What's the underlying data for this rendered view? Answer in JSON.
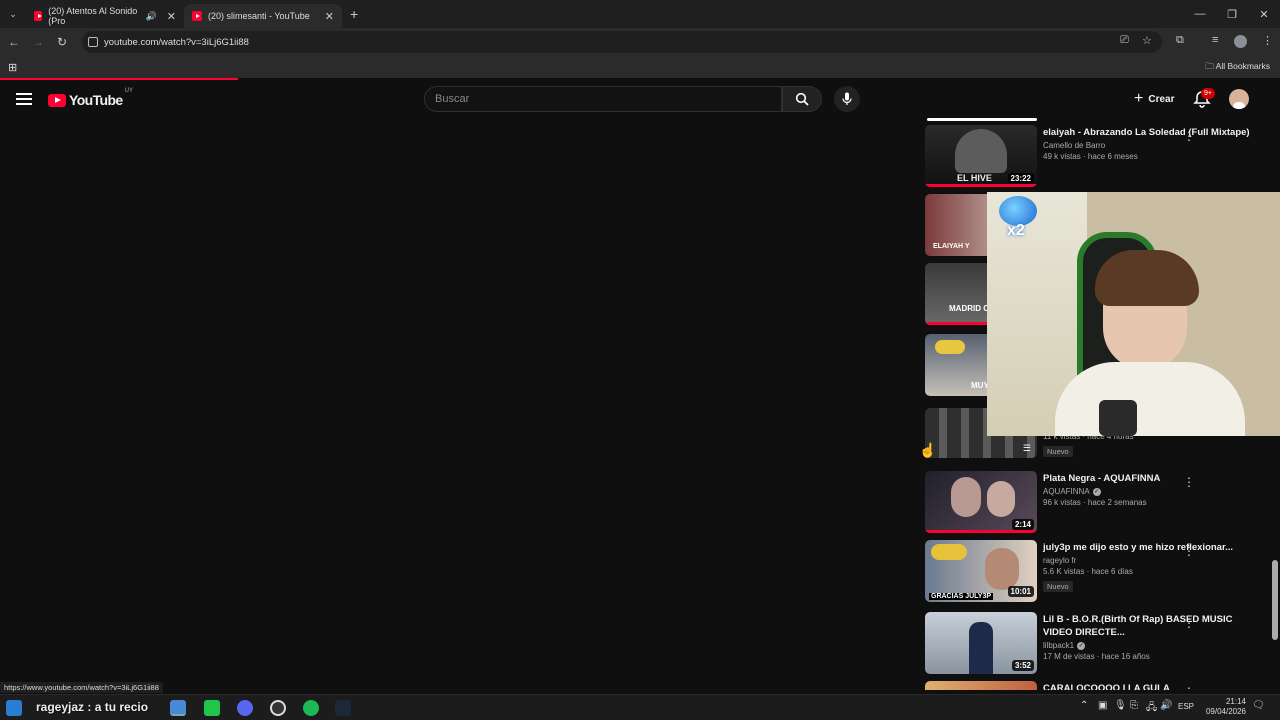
{
  "browser": {
    "tabs": [
      {
        "title": "(20) Atentos Al Sonido (Pro",
        "active": false
      },
      {
        "title": "(20) slimesanti - YouTube",
        "active": true
      }
    ],
    "url": "youtube.com/watch?v=3iLj6G1ii88",
    "bookmarks_label": "All Bookmarks"
  },
  "youtube": {
    "logo_text": "YouTube",
    "country_code": "UY",
    "search_placeholder": "Buscar",
    "create_label": "Crear",
    "notifications_badge": "9+"
  },
  "sidebar": {
    "videos": [
      {
        "title": "elaiyah - Abrazando La Soledad (Full Mixtape)",
        "channel": "Camello de Barro",
        "views": "49 k vistas · hace 6 meses",
        "duration": "23:22",
        "thumb_text": "EL HIVE",
        "badge": ""
      },
      {
        "title": "",
        "channel": "",
        "views": "",
        "duration": "",
        "thumb_text": "ELAIYAH Y",
        "badge": ""
      },
      {
        "title": "",
        "channel": "",
        "views": "",
        "duration": "",
        "thumb_text": "MADRID C",
        "badge": ""
      },
      {
        "title": "",
        "channel": "",
        "views": "",
        "duration": "",
        "thumb_text": "MUY",
        "badge": ""
      },
      {
        "title": "",
        "channel": "",
        "views": "11 k vistas · hace 4 horas",
        "duration": "",
        "thumb_text": "",
        "badge": "Nuevo"
      },
      {
        "title": "Plata Negra - AQUAFINNA",
        "channel": "AQUAFINNA",
        "views": "96 k vistas · hace 2 semanas",
        "duration": "2:14",
        "thumb_text": "",
        "badge": ""
      },
      {
        "title": "july3p me dijo esto y me hizo reflexionar...",
        "channel": "rageylo fr",
        "views": "5.6 K vistas · hace 6 días",
        "duration": "10:01",
        "thumb_text": "GRACIAS JULY3P",
        "badge": "Nuevo"
      },
      {
        "title": "Lil B - B.O.R.(Birth Of Rap) BASED MUSIC VIDEO DIRECTE...",
        "channel": "lilbpack1",
        "views": "17 M de vistas · hace 16 años",
        "duration": "3:52",
        "thumb_text": "",
        "badge": ""
      },
      {
        "title": "CARALOCOOOO I LA GULA",
        "channel": "",
        "views": "",
        "duration": "",
        "thumb_text": "",
        "badge": ""
      }
    ]
  },
  "overlay": {
    "multiplier": "x2"
  },
  "status_url": "https://www.youtube.com/watch?v=3iLj6G1ii88",
  "taskbar": {
    "stream_text": "rageyjaz : a tu recio",
    "language": "ESP",
    "time": "21:14",
    "date": "09/04/2026"
  },
  "colors": {
    "accent": "#ff0033",
    "bg": "#0f0f0f"
  }
}
